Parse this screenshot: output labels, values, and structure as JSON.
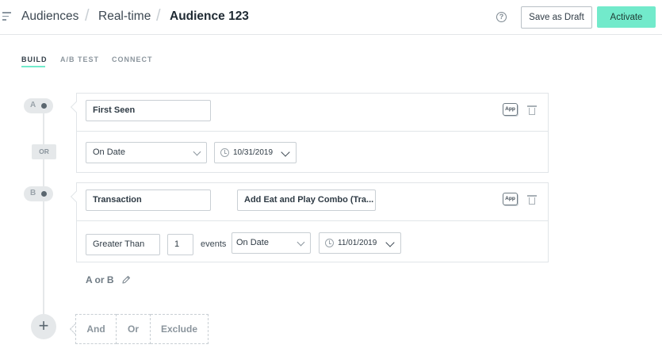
{
  "header": {
    "breadcrumbs": [
      "Audiences",
      "Real-time",
      "Audience 123"
    ],
    "help_icon": "question-circle-icon",
    "save_draft_label": "Save as Draft",
    "activate_label": "Activate",
    "accent_color": "#72eacb"
  },
  "tabs": [
    {
      "label": "BUILD",
      "active": true
    },
    {
      "label": "A/B TEST",
      "active": false
    },
    {
      "label": "CONNECT",
      "active": false
    }
  ],
  "timeline": {
    "or_label": "OR",
    "add_icon": "+"
  },
  "group_a": {
    "letter": "A",
    "event_name": "First Seen",
    "app_badge": "App",
    "date_operator": "On Date",
    "date_value": "10/31/2019"
  },
  "group_b": {
    "letter": "B",
    "event_name": "Transaction",
    "property_value": "Add Eat and Play Combo (Tra...",
    "app_badge": "App",
    "count_operator": "Greater Than",
    "count_value": "1",
    "count_unit": "events",
    "date_operator": "On Date",
    "date_value": "11/01/2019"
  },
  "logic": {
    "expression": "A or B"
  },
  "combinators": [
    "And",
    "Or",
    "Exclude"
  ]
}
